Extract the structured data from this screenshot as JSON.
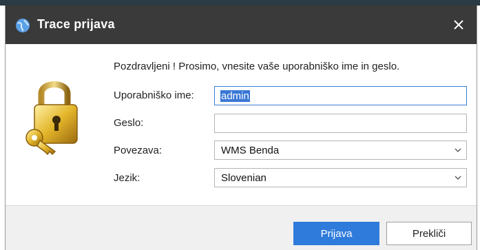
{
  "window": {
    "title": "Trace prijava"
  },
  "form": {
    "greeting": "Pozdravljeni !  Prosimo, vnesite vaše uporabniško ime in geslo.",
    "username_label": "Uporabniško ime:",
    "username_value": "admin",
    "password_label": "Geslo:",
    "password_value": "",
    "connection_label": "Povezava:",
    "connection_value": "WMS Benda",
    "language_label": "Jezik:",
    "language_value": "Slovenian"
  },
  "buttons": {
    "login_label": "Prijava",
    "cancel_label": "Prekliči"
  },
  "colors": {
    "titlebar": "#3a3a3a",
    "primary_button": "#2f7bdc",
    "footer": "#f0f0f0"
  },
  "icons": {
    "app": "globe-icon",
    "close": "close-icon",
    "login": "lock-key-icon",
    "dropdown": "chevron-down-icon"
  }
}
